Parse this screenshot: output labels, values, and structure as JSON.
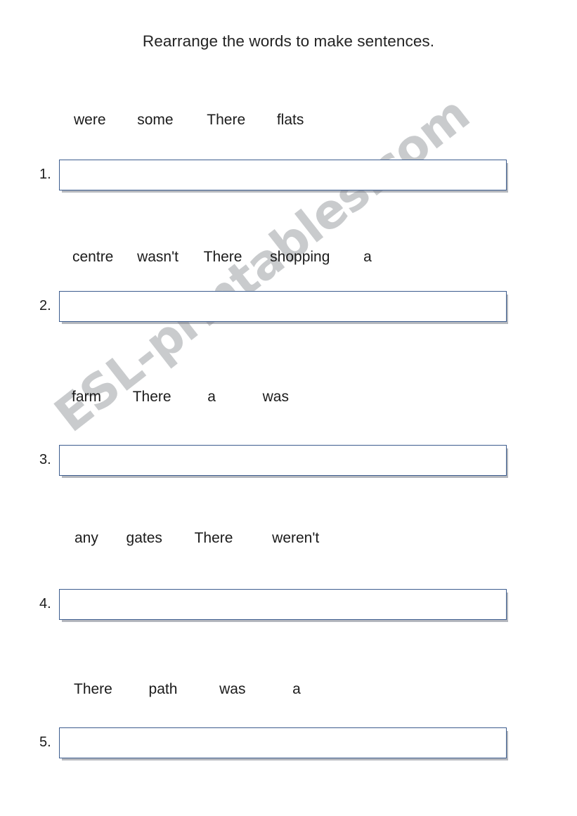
{
  "page": {
    "title": "Rearrange the words to make sentences.",
    "watermark": "ESL-printables.com",
    "accent_color": "#3c5c8e",
    "text_color": "#1b1b1b",
    "watermark_color": "#c9cbcd",
    "background_color": "#ffffff"
  },
  "exercises": [
    {
      "number": "1.",
      "words": [
        "were",
        "some",
        "There",
        "flats"
      ],
      "answer": ""
    },
    {
      "number": "2.",
      "words": [
        "centre",
        "wasn't",
        "There",
        "shopping",
        "a"
      ],
      "answer": ""
    },
    {
      "number": "3.",
      "words": [
        "farm",
        "There",
        "a",
        "was"
      ],
      "answer": ""
    },
    {
      "number": "4.",
      "words": [
        "any",
        "gates",
        "There",
        "weren't"
      ],
      "answer": ""
    },
    {
      "number": "5.",
      "words": [
        "There",
        "path",
        "was",
        "a"
      ],
      "answer": ""
    }
  ]
}
